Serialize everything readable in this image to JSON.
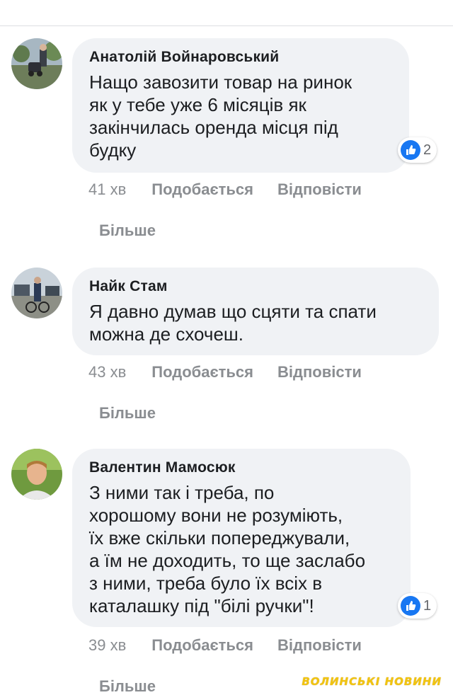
{
  "comments": [
    {
      "author": "Анатолій Войнаровський",
      "text": "Нащо завозити товар на ринок\nяк у тебе уже 6 місяців як\nзакінчилась оренда місця під\nбудку",
      "reaction_count": "2",
      "time": "41 хв",
      "like_label": "Подобається",
      "reply_label": "Відповісти",
      "more_label": "Більше"
    },
    {
      "author": "Найк Стам",
      "text": "Я давно думав що сцяти та спати\nможна де схочеш.",
      "time": "43 хв",
      "like_label": "Подобається",
      "reply_label": "Відповісти",
      "more_label": "Більше"
    },
    {
      "author": "Валентин Мамосюк",
      "text": "З ними так і треба, по\nхорошому вони не розуміють,\nїх вже скільки попереджували,\nа їм не доходить, то ще заслабо\nз ними, треба було їх всіх в\nкаталашку під \"білі ручки\"!",
      "reaction_count": "1",
      "time": "39 хв",
      "like_label": "Подобається",
      "reply_label": "Відповісти",
      "more_label": "Більше"
    }
  ],
  "watermark": "ВОЛИНСЬКІ НОВИНИ",
  "colors": {
    "bubble": "#f0f2f5",
    "like_blue": "#1877f2",
    "meta_gray": "#8a8d91",
    "watermark": "#f1c40f"
  }
}
